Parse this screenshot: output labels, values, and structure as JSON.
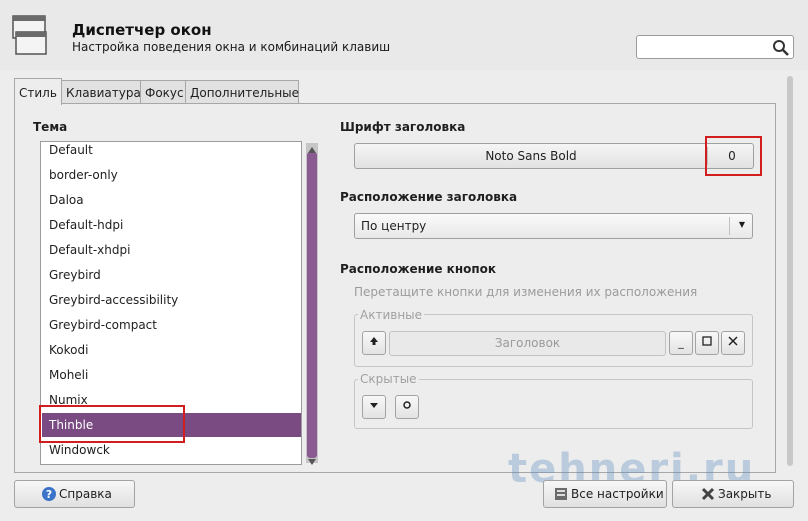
{
  "window": {
    "title": "Диспетчер окон",
    "subtitle": "Настройка поведения окна и комбинаций клавиш",
    "search_placeholder": ""
  },
  "tabs": [
    {
      "label": "Стиль",
      "active": true
    },
    {
      "label": "Клавиатура",
      "active": false
    },
    {
      "label": "Фокус",
      "active": false
    },
    {
      "label": "Дополнительные",
      "active": false
    }
  ],
  "style_tab": {
    "theme_label": "Тема",
    "themes": [
      "Default",
      "border-only",
      "Daloa",
      "Default-hdpi",
      "Default-xhdpi",
      "Greybird",
      "Greybird-accessibility",
      "Greybird-compact",
      "Kokodi",
      "Moheli",
      "Numix",
      "Thinble",
      "Windowck"
    ],
    "selected_theme": "Thinble",
    "title_font_label": "Шрифт заголовка",
    "title_font_name": "Noto Sans Bold",
    "title_font_size": "0",
    "title_alignment_label": "Расположение заголовка",
    "title_alignment_value": "По центру",
    "button_layout_label": "Расположение кнопок",
    "button_layout_hint": "Перетащите кнопки для изменения их расположения",
    "active_group_label": "Активные",
    "title_item_label": "Заголовок",
    "hidden_group_label": "Скрытые"
  },
  "bottom": {
    "help_label": "Справка",
    "all_settings_label": "Все настройки",
    "close_label": "Закрыть"
  },
  "watermark": "tehneri.ru",
  "colors": {
    "selection": "#7a4a82",
    "highlight_box": "#d11f1f"
  }
}
